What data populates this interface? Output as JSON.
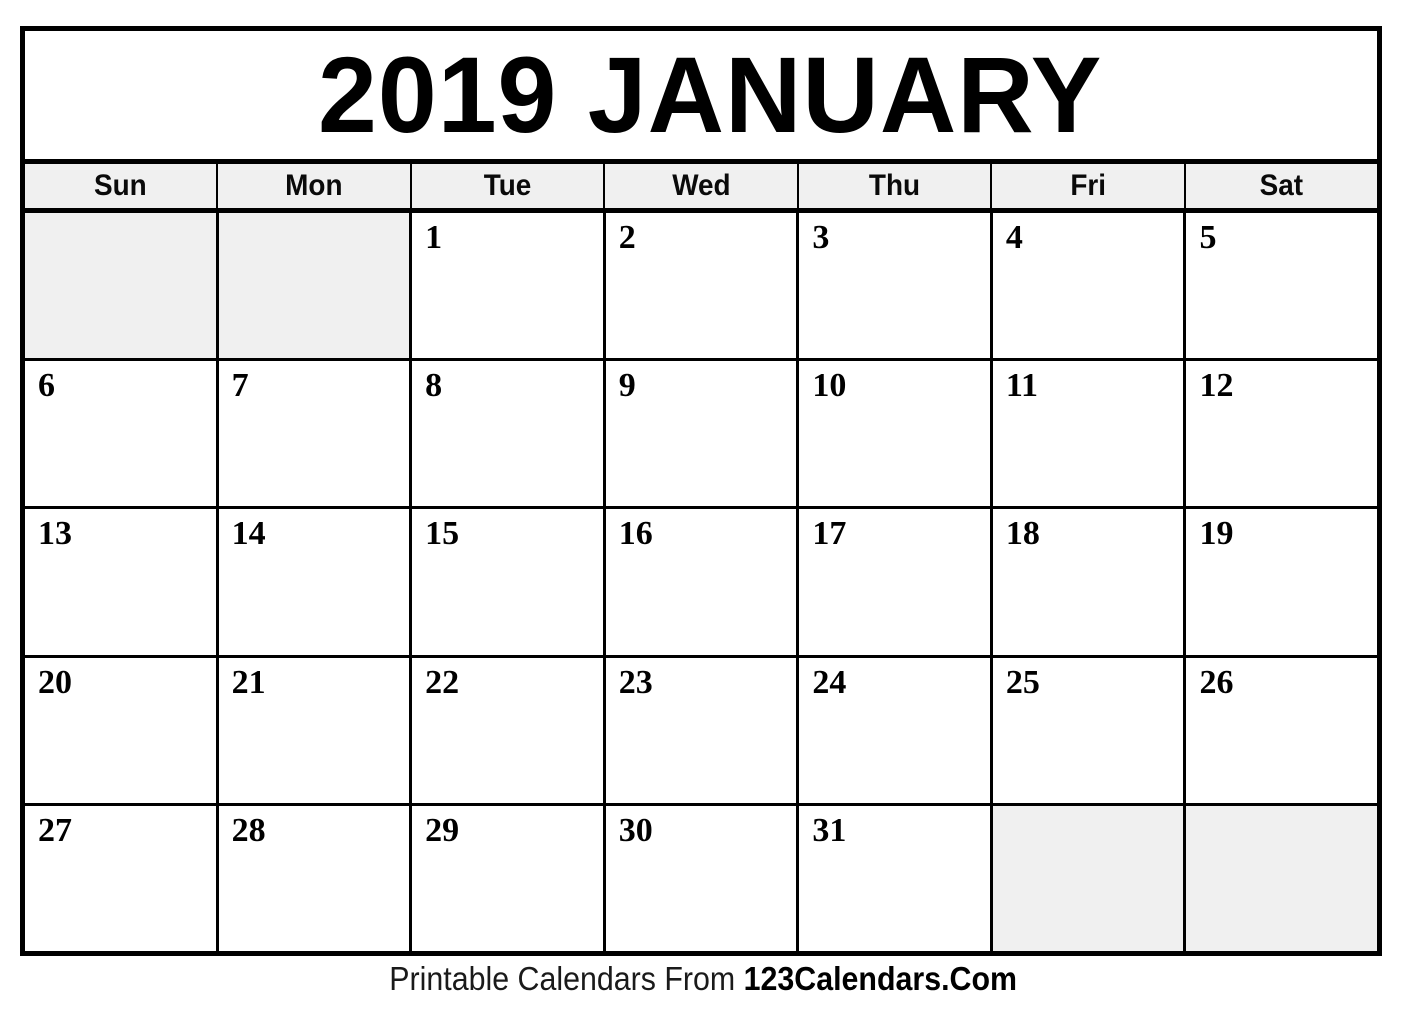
{
  "calendar": {
    "title": "2019 JANUARY",
    "year": "2019",
    "month": "JANUARY",
    "weekday_headers": [
      "Sun",
      "Mon",
      "Tue",
      "Wed",
      "Thu",
      "Fri",
      "Sat"
    ],
    "weeks": [
      [
        {
          "label": "",
          "blank": true
        },
        {
          "label": "",
          "blank": true
        },
        {
          "label": "1",
          "blank": false
        },
        {
          "label": "2",
          "blank": false
        },
        {
          "label": "3",
          "blank": false
        },
        {
          "label": "4",
          "blank": false
        },
        {
          "label": "5",
          "blank": false
        }
      ],
      [
        {
          "label": "6",
          "blank": false
        },
        {
          "label": "7",
          "blank": false
        },
        {
          "label": "8",
          "blank": false
        },
        {
          "label": "9",
          "blank": false
        },
        {
          "label": "10",
          "blank": false
        },
        {
          "label": "11",
          "blank": false
        },
        {
          "label": "12",
          "blank": false
        }
      ],
      [
        {
          "label": "13",
          "blank": false
        },
        {
          "label": "14",
          "blank": false
        },
        {
          "label": "15",
          "blank": false
        },
        {
          "label": "16",
          "blank": false
        },
        {
          "label": "17",
          "blank": false
        },
        {
          "label": "18",
          "blank": false
        },
        {
          "label": "19",
          "blank": false
        }
      ],
      [
        {
          "label": "20",
          "blank": false
        },
        {
          "label": "21",
          "blank": false
        },
        {
          "label": "22",
          "blank": false
        },
        {
          "label": "23",
          "blank": false
        },
        {
          "label": "24",
          "blank": false
        },
        {
          "label": "25",
          "blank": false
        },
        {
          "label": "26",
          "blank": false
        }
      ],
      [
        {
          "label": "27",
          "blank": false
        },
        {
          "label": "28",
          "blank": false
        },
        {
          "label": "29",
          "blank": false
        },
        {
          "label": "30",
          "blank": false
        },
        {
          "label": "31",
          "blank": false
        },
        {
          "label": "",
          "blank": true
        },
        {
          "label": "",
          "blank": true
        }
      ]
    ]
  },
  "footer": {
    "prefix": "Printable Calendars From ",
    "brand": "123Calendars.Com"
  },
  "colors": {
    "border": "#000000",
    "blank_cell": "#f0f0f0",
    "header_cell": "#f0f0f0",
    "page_background": "#ffffff",
    "text": "#000000"
  }
}
